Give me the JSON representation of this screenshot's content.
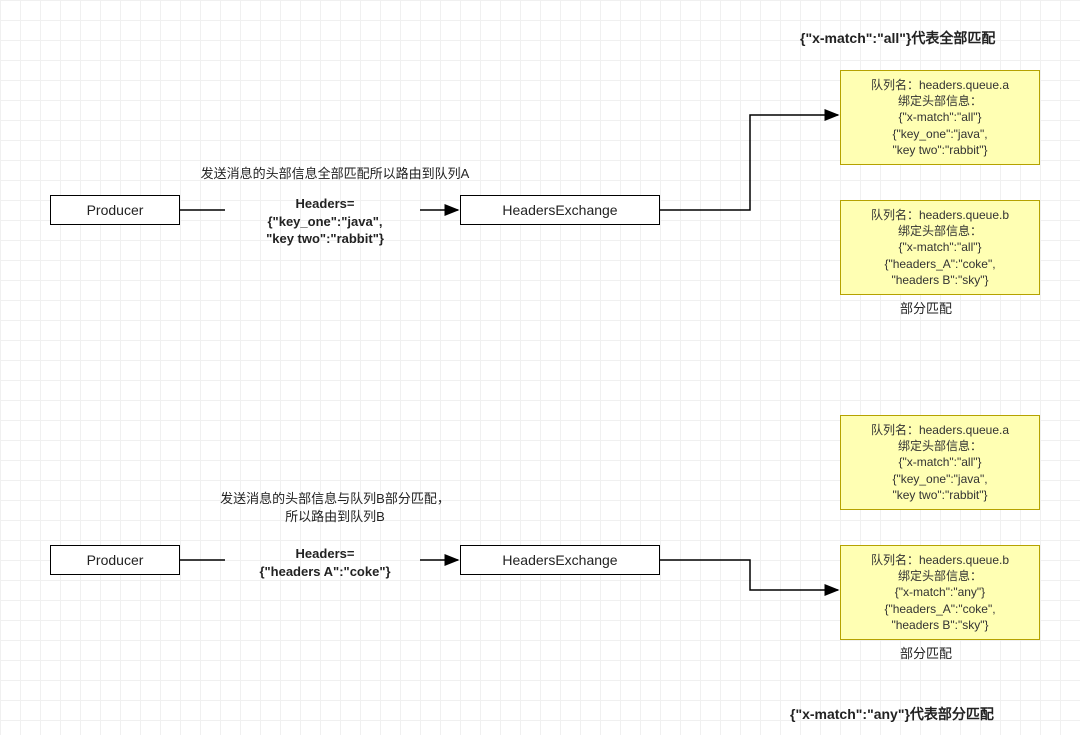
{
  "title_top": "{\"x-match\":\"all\"}代表全部匹配",
  "title_bottom": "{\"x-match\":\"any\"}代表部分匹配",
  "section1": {
    "producer": "Producer",
    "exchange": "HeadersExchange",
    "caption": "发送消息的头部信息全部匹配所以路由到队列A",
    "headers_title": "Headers=",
    "headers_l1": "{\"key_one\":\"java\",",
    "headers_l2": "\"key two\":\"rabbit\"}",
    "queueA": {
      "l1": "队列名：headers.queue.a",
      "l2": "绑定头部信息：",
      "l3": "{\"x-match\":\"all\"}",
      "l4": "{\"key_one\":\"java\",",
      "l5": "\"key two\":\"rabbit\"}"
    },
    "queueB": {
      "l1": "队列名：headers.queue.b",
      "l2": "绑定头部信息：",
      "l3": "{\"x-match\":\"all\"}",
      "l4": "{\"headers_A\":\"coke\",",
      "l5": "\"headers B\":\"sky\"}"
    },
    "partial_label": "部分匹配"
  },
  "section2": {
    "producer": "Producer",
    "exchange": "HeadersExchange",
    "caption_l1": "发送消息的头部信息与队列B部分匹配，",
    "caption_l2": "所以路由到队列B",
    "headers_title": "Headers=",
    "headers_l1": "{\"headers A\":\"coke\"}",
    "queueA": {
      "l1": "队列名：headers.queue.a",
      "l2": "绑定头部信息：",
      "l3": "{\"x-match\":\"all\"}",
      "l4": "{\"key_one\":\"java\",",
      "l5": "\"key two\":\"rabbit\"}"
    },
    "queueB": {
      "l1": "队列名：headers.queue.b",
      "l2": "绑定头部信息：",
      "l3": "{\"x-match\":\"any\"}",
      "l4": "{\"headers_A\":\"coke\",",
      "l5": "\"headers B\":\"sky\"}"
    },
    "partial_label": "部分匹配"
  }
}
